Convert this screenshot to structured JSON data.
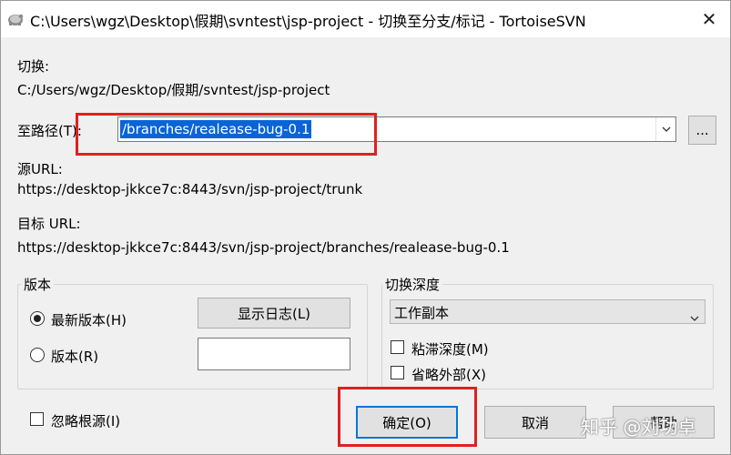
{
  "window": {
    "title": "C:\\Users\\wgz\\Desktop\\假期\\svntest\\jsp-project - 切换至分支/标记 - TortoiseSVN",
    "close_glyph": "✕"
  },
  "switch_section": {
    "label": "切换:",
    "path": "C:/Users/wgz/Desktop/假期/svntest/jsp-project"
  },
  "to_path": {
    "label": "至路径(T):",
    "value": "/branches/realease-bug-0.1",
    "browse_label": "..."
  },
  "source_url": {
    "label": "源URL:",
    "value": "https://desktop-jkkce7c:8443/svn/jsp-project/trunk"
  },
  "target_url": {
    "label": "目标 URL:",
    "value": "https://desktop-jkkce7c:8443/svn/jsp-project/branches/realease-bug-0.1"
  },
  "revision_group": {
    "title": "版本",
    "head_label": "最新版本(H)",
    "rev_label": "版本(R)",
    "show_log_label": "显示日志(L)",
    "rev_value": ""
  },
  "depth_group": {
    "title": "切换深度",
    "depth_value": "工作副本",
    "sticky_label": "粘滞深度(M)",
    "omit_externals_label": "省略外部(X)"
  },
  "ignore_ancestry_label": "忽略根源(I)",
  "buttons": {
    "ok": "确定(O)",
    "cancel": "取消",
    "help": "帮助"
  },
  "watermark": "知乎 @刘功卓",
  "colors": {
    "selection": "#0a64d6",
    "highlight": "#e02020",
    "default_button_border": "#0078d7"
  }
}
